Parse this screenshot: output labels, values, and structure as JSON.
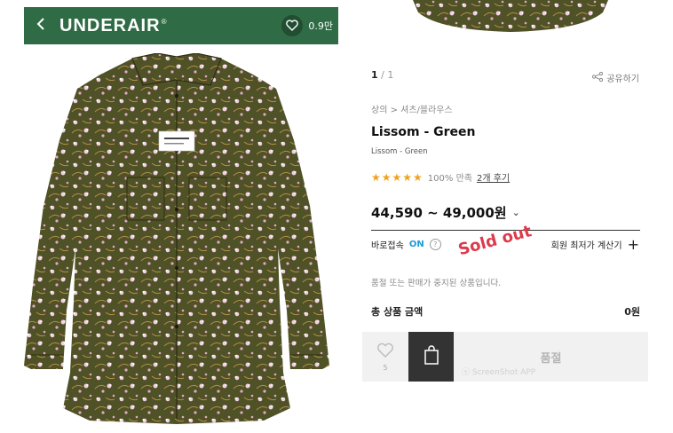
{
  "header": {
    "back_icon": "chevron-left-icon",
    "brand": "UNDERAIR",
    "brand_mark": "®",
    "like_count": "0.9만"
  },
  "product": {
    "image_counter": "1",
    "image_total": "1",
    "share_label": "공유하기",
    "breadcrumb": "상의 > 셔츠/블라우스",
    "name": "Lissom - Green",
    "subname": "Lissom - Green",
    "stars": "★★★★★",
    "satisfaction": "100% 만족",
    "review_link": "2개 후기",
    "price": "44,590 ~ 49,000원",
    "price_chevron": "⌄"
  },
  "quick": {
    "label": "바로접속",
    "state": "ON",
    "help": "?"
  },
  "calc": {
    "label": "회원 최저가 계산기",
    "plus": "+"
  },
  "stamp": "Sold out",
  "notice": "품절 또는 판매가 중지된 상품입니다.",
  "total": {
    "label": "총 상품 금액",
    "value": "0원"
  },
  "actions": {
    "wish_count": "5",
    "soldout_label": "품절"
  },
  "watermark": "ⓢ ScreenShot APP",
  "colors": {
    "header_green": "#2f6b45",
    "shirt_base": "#4f5126",
    "flower_pink": "#f1cfe0",
    "accent_blue": "#1a9ad6",
    "stamp_red": "#dc3b4c"
  }
}
